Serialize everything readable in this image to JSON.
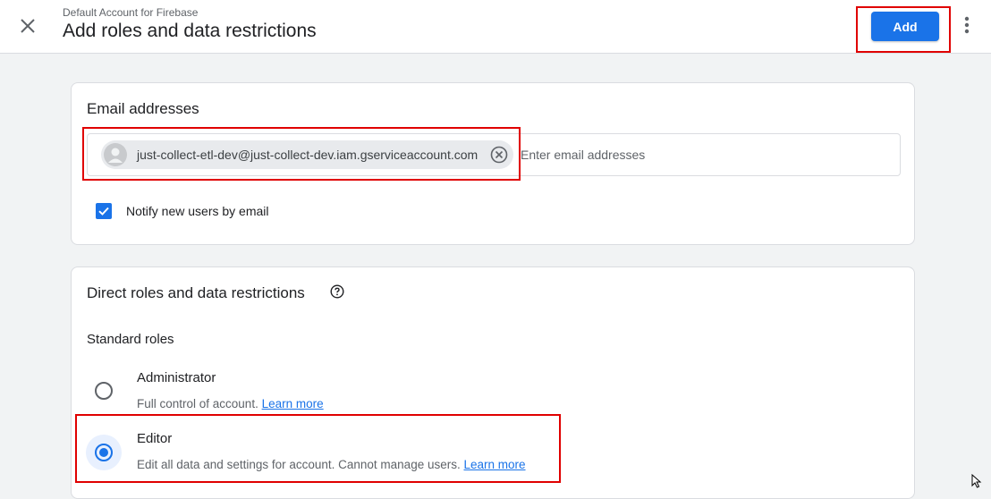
{
  "header": {
    "account_name": "Default Account for Firebase",
    "title": "Add roles and data restrictions",
    "add_label": "Add"
  },
  "email_section": {
    "title": "Email addresses",
    "chip_email": "just-collect-etl-dev@just-collect-dev.iam.gserviceaccount.com",
    "input_placeholder": "Enter email addresses",
    "input_value": "",
    "notify_label": "Notify new users by email",
    "notify_checked": true
  },
  "roles_section": {
    "title": "Direct roles and data restrictions",
    "standard_roles_label": "Standard roles",
    "roles": [
      {
        "name": "Administrator",
        "description": "Full control of account.",
        "link": "Learn more",
        "selected": false
      },
      {
        "name": "Editor",
        "description": "Edit all data and settings for account. Cannot manage users.",
        "link": "Learn more",
        "selected": true
      }
    ]
  },
  "icons": {
    "close": "close-icon",
    "more": "more-vert-icon",
    "avatar": "person-icon",
    "remove": "cancel-circle-icon",
    "check": "check-icon",
    "help": "help-circle-icon"
  },
  "colors": {
    "accent": "#1a73e8",
    "highlight": "#e00000",
    "background": "#f1f3f4"
  }
}
